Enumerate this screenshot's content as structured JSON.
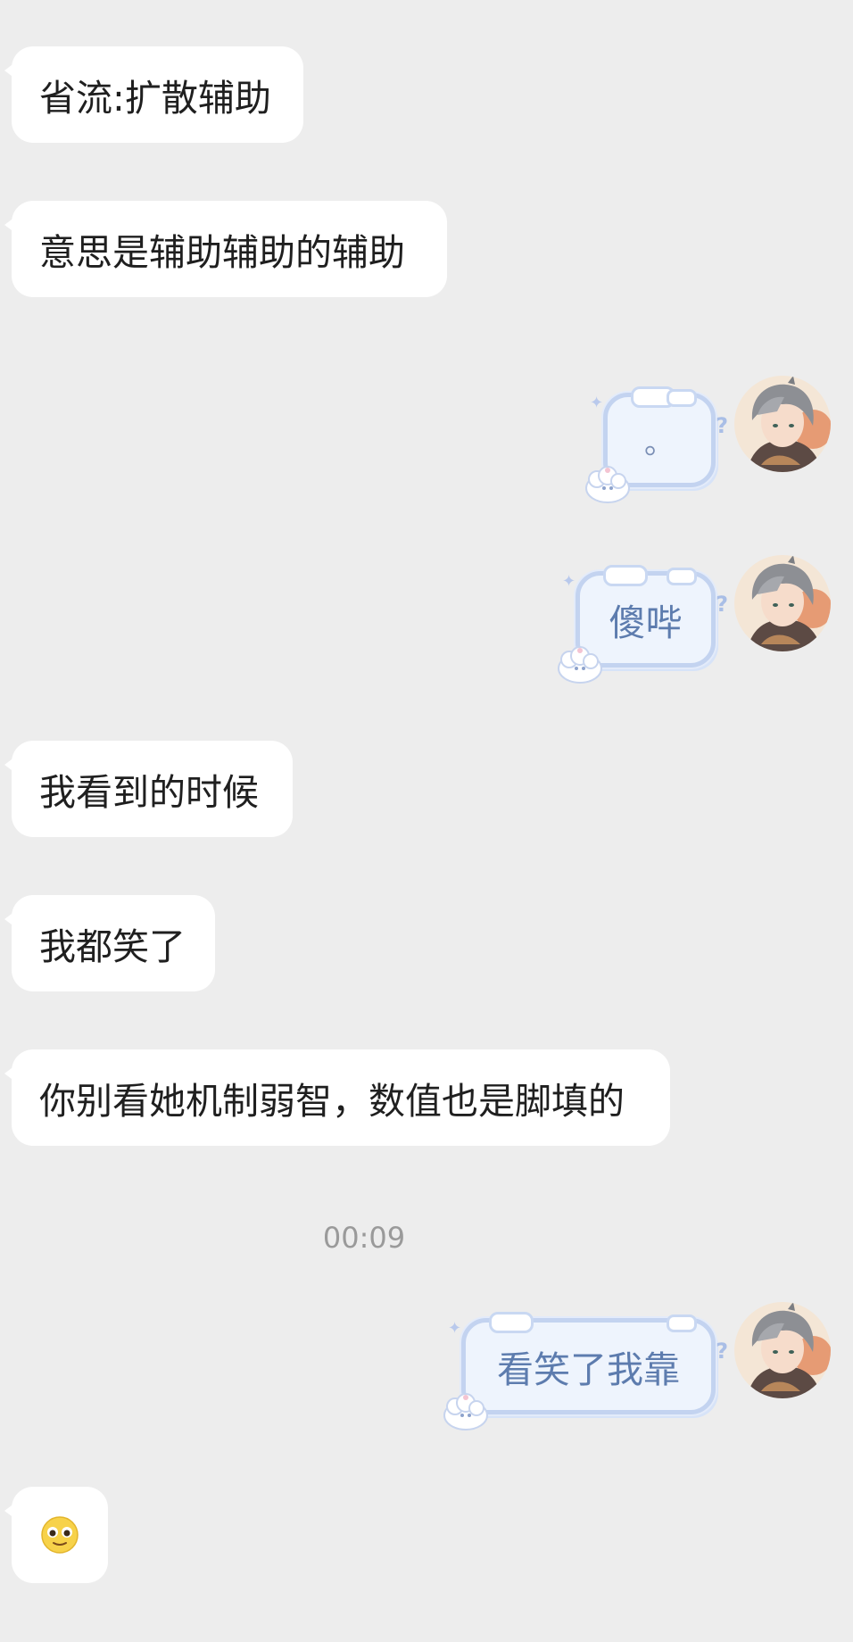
{
  "messages": [
    {
      "side": "left",
      "text": "省流:扩散辅助"
    },
    {
      "side": "left",
      "text": "意思是辅助辅助的辅助"
    },
    {
      "side": "right",
      "text": "。"
    },
    {
      "side": "right",
      "text": "傻哔"
    },
    {
      "side": "left",
      "text": "我看到的时候"
    },
    {
      "side": "left",
      "text": "我都笑了"
    },
    {
      "side": "left",
      "text": "你别看她机制弱智，数值也是脚填的"
    },
    {
      "side": "right",
      "text": "看笑了我靠"
    },
    {
      "side": "left",
      "emoji": "pleading-smile-emoji"
    }
  ],
  "timestamp": "00:09",
  "colors": {
    "background": "#ededed",
    "left_bubble": "#ffffff",
    "right_bubble_fill": "#eef4fd",
    "right_bubble_border": "#c3d3f0",
    "right_text": "#5d7cae"
  }
}
